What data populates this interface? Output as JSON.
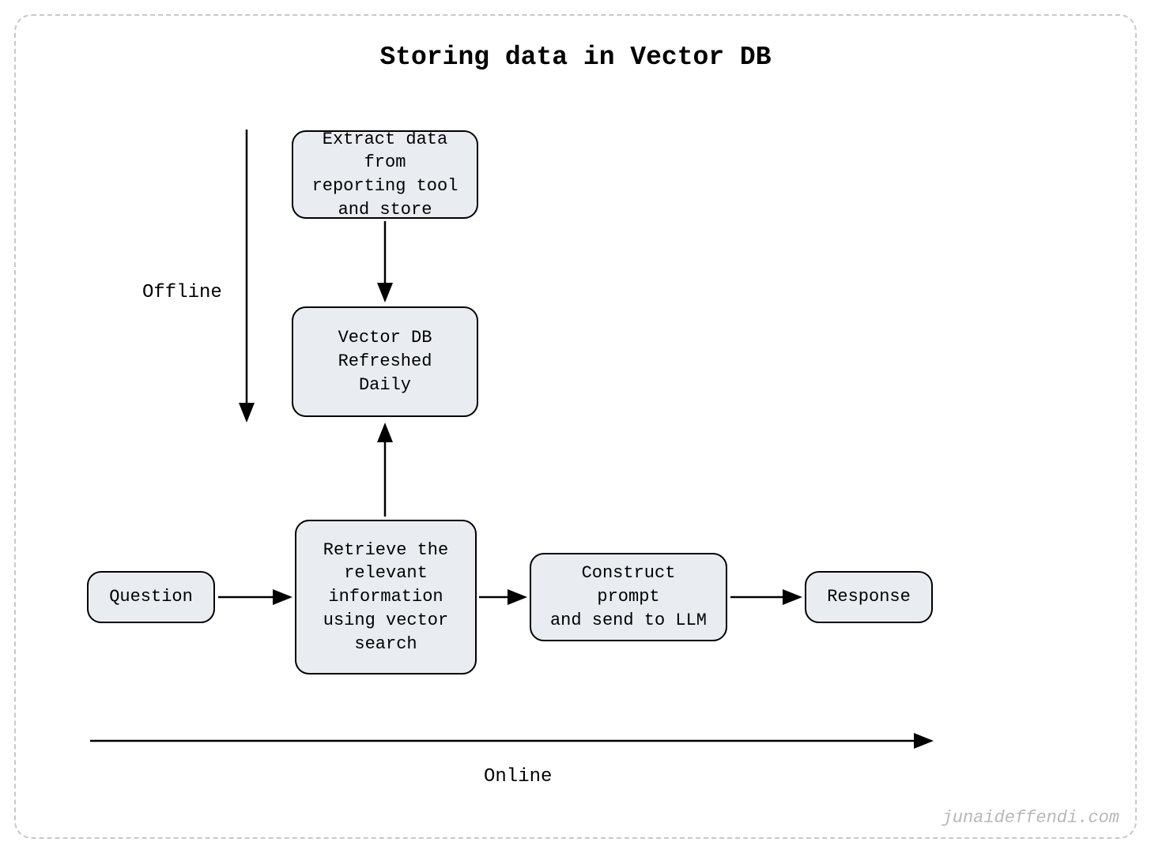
{
  "title": "Storing data in Vector DB",
  "labels": {
    "offline": "Offline",
    "online": "Online"
  },
  "boxes": {
    "extract": "Extract data from\nreporting tool\nand store",
    "vectordb": "Vector DB\nRefreshed Daily",
    "question": "Question",
    "retrieve": "Retrieve the\nrelevant\ninformation\nusing vector\nsearch",
    "construct": "Construct prompt\nand send to LLM",
    "response": "Response"
  },
  "attribution": "junaideffendi.com"
}
